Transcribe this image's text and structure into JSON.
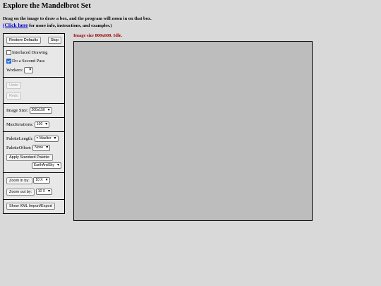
{
  "header": {
    "title": "Explore the Mandelbrot Set",
    "intro_line1": "Drag on the image to draw a box, and the program will zoom in on that box.",
    "intro_link": "(Click here",
    "intro_line2_rest": " for more info, instructions, and examples.)"
  },
  "controls": {
    "restore_defaults": "Restore Defaults",
    "stop": "Stop",
    "interlaced_label": "Interlaced Drawing",
    "interlaced_checked": false,
    "second_pass_label": "Do a Second Pass",
    "second_pass_checked": true,
    "workers_label": "Workers:",
    "workers_value": "",
    "undo": "Undo",
    "redo": "Redo",
    "image_size_label": "Image Size:",
    "image_size_value": "200x150",
    "max_iterations_label": "MaxIterations:",
    "max_iterations_value": "100",
    "palette_length_label": "PaletteLength:",
    "palette_length_value": "= MaxIter",
    "palette_offset_label": "PaletteOffset:",
    "palette_offset_value": "None",
    "apply_palette": "Apply Standard Palette:",
    "palette_value": "EarthAndSky",
    "zoom_in": "Zoom in by:",
    "zoom_in_value": "10 X",
    "zoom_out": "Zoom out by:",
    "zoom_out_value": "10 X",
    "xml_import_export": "Show XML Import/Export"
  },
  "status": "Image size 800x600. Idle.",
  "colors": {
    "status_text": "#a00000",
    "canvas_bg": "#bdbdbd",
    "link": "#0000cc"
  }
}
